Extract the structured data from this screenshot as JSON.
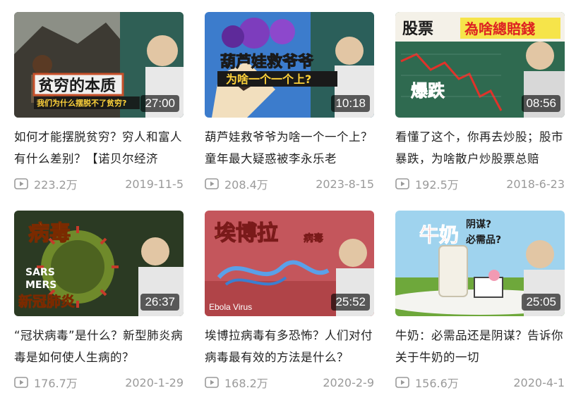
{
  "videos": [
    {
      "thumb_text": [
        "贫穷的本质",
        "我们为什么摆脱不了贫穷?"
      ],
      "duration": "27:00",
      "title": "如何才能摆脱贫穷？穷人和富人有什么差别？【诺贝尔经济",
      "views": "223.2万",
      "date": "2019-11-5",
      "play_icon": "play-icon"
    },
    {
      "thumb_text": [
        "葫芦娃救爷爷",
        "为啥一个一个上?"
      ],
      "duration": "10:18",
      "title": "葫芦娃救爷爷为啥一个一个上？童年最大疑惑被李永乐老",
      "views": "208.4万",
      "date": "2023-8-15",
      "play_icon": "play-icon"
    },
    {
      "thumb_text": [
        "股票",
        "為啥總賠錢",
        "爆跌"
      ],
      "duration": "08:56",
      "title": "看懂了这个，你再去炒股；股市暴跌，为啥散户炒股票总赔",
      "views": "192.5万",
      "date": "2018-6-23",
      "play_icon": "play-icon"
    },
    {
      "thumb_text": [
        "病毒",
        "SARS",
        "MERS",
        "新冠肺炎"
      ],
      "duration": "26:37",
      "title": "“冠状病毒”是什么？新型肺炎病毒是如何使人生病的？",
      "views": "176.7万",
      "date": "2020-1-29",
      "play_icon": "play-icon"
    },
    {
      "thumb_text": [
        "埃博拉",
        "病毒",
        "Ebola Virus"
      ],
      "duration": "25:52",
      "title": "埃博拉病毒有多恐怖？人们对付病毒最有效的方法是什么？",
      "views": "168.2万",
      "date": "2020-2-9",
      "play_icon": "play-icon"
    },
    {
      "thumb_text": [
        "牛奶",
        "阴谋?",
        "必需品?"
      ],
      "duration": "25:05",
      "title": "牛奶：必需品还是阴谋？告诉你关于牛奶的一切",
      "views": "156.6万",
      "date": "2020-4-1",
      "play_icon": "play-icon"
    }
  ]
}
